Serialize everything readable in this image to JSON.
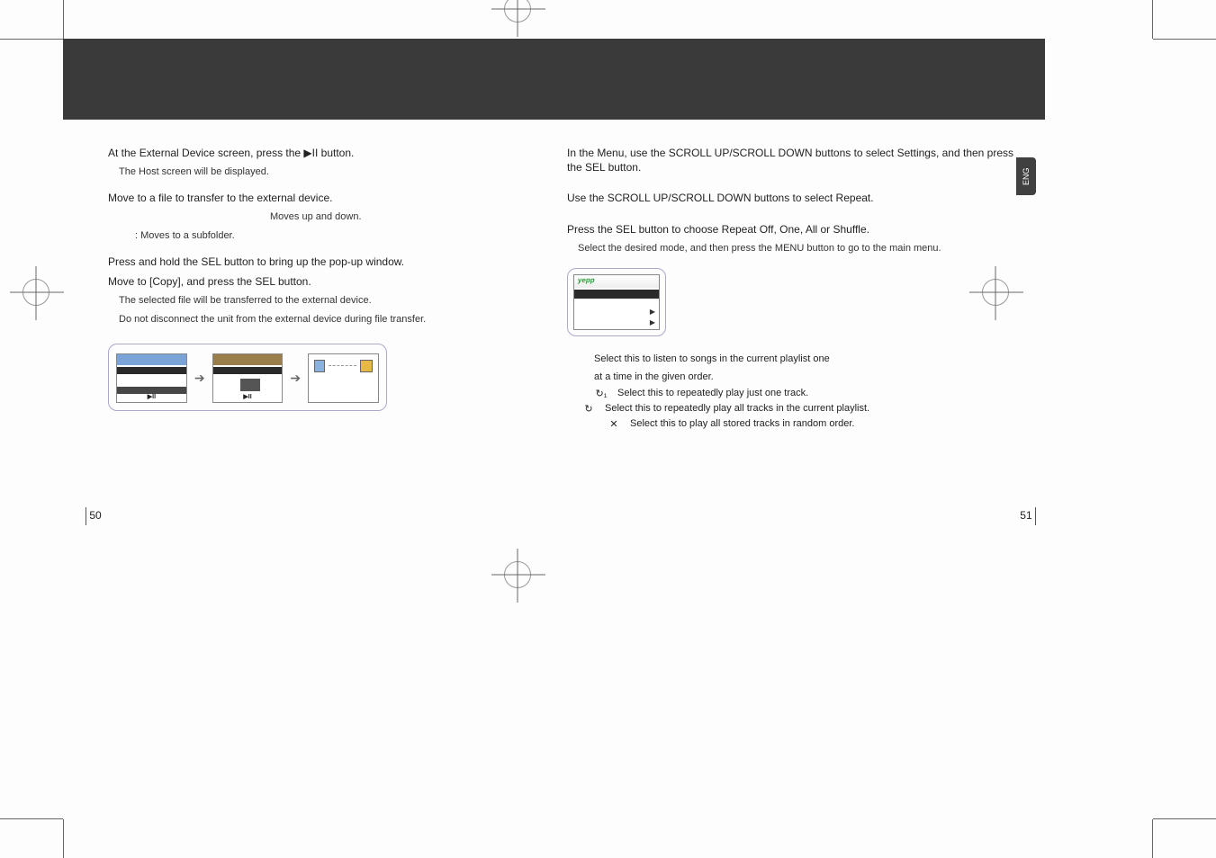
{
  "lang_tab": "ENG",
  "left": {
    "s1": "At the External Device screen, press the ▶II button.",
    "s1_sub": "The Host screen will be displayed.",
    "s2": "Move to a file to transfer to the external device.",
    "s2_sub1": "Moves up and down.",
    "s2_sub2": ": Moves to a subfolder.",
    "s3a": "Press and hold the SEL button to bring up the pop-up window.",
    "s3b": "Move to [Copy], and press the SEL button.",
    "s3_sub1": "The selected file will be transferred to the external device.",
    "s3_sub2": "Do not disconnect the unit from the external device during file transfer."
  },
  "right": {
    "s1": "In the Menu, use the SCROLL UP/SCROLL DOWN buttons to select Settings, and then press the SEL button.",
    "s2": "Use the SCROLL UP/SCROLL DOWN buttons to select Repeat.",
    "s3": "Press the SEL button to choose Repeat Off, One, All or Shuffle.",
    "s3_sub": "Select the desired mode, and then press the MENU button to go to the main menu.",
    "opt_off_a": "Select this to listen to songs in the current playlist one",
    "opt_off_b": "at a time in the given order.",
    "opt_one": "Select this to repeatedly play just one track.",
    "opt_all": "Select this to repeatedly play all tracks in the current playlist.",
    "opt_shuffle": "Select this to play all stored tracks in random order."
  },
  "icons": {
    "repeat_one": "↻₁",
    "repeat_all": "↻",
    "shuffle": "✕"
  },
  "pagenum": {
    "left": "50",
    "right": "51"
  },
  "panel": {
    "logo": "yepp",
    "arrow": "▶"
  }
}
